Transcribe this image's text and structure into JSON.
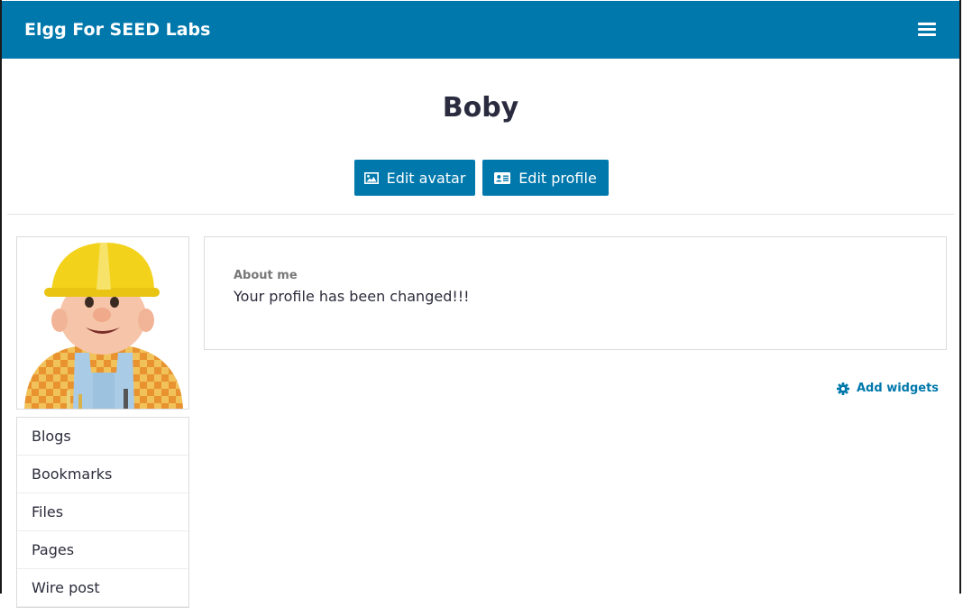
{
  "header": {
    "site_title": "Elgg For SEED Labs",
    "menu_icon": "hamburger-icon"
  },
  "profile": {
    "name": "Boby",
    "actions": {
      "edit_avatar": "Edit avatar",
      "edit_avatar_icon": "image-icon",
      "edit_profile": "Edit profile",
      "edit_profile_icon": "id-card-icon"
    },
    "about_label": "About me",
    "about_value": "Your profile has been changed!!!"
  },
  "owner_menu": {
    "items": [
      "Blogs",
      "Bookmarks",
      "Files",
      "Pages",
      "Wire post"
    ]
  },
  "widgets": {
    "add_label": "Add widgets",
    "add_icon": "gear-icon"
  },
  "colors": {
    "brand": "#0078ac",
    "text": "#2c2c3c",
    "muted": "#777777"
  }
}
